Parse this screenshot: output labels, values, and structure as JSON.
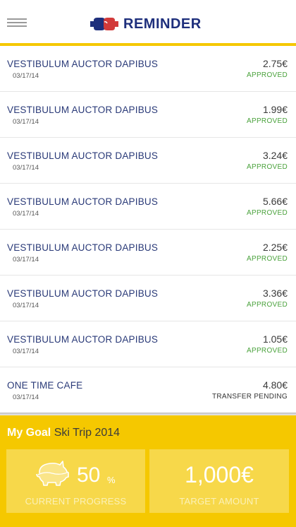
{
  "header": {
    "title": "REMINDER"
  },
  "transactions": [
    {
      "name": "VESTIBULUM AUCTOR DAPIBUS",
      "date": "03/17/14",
      "amount": "2.75€",
      "status": "APPROVED"
    },
    {
      "name": "VESTIBULUM AUCTOR DAPIBUS",
      "date": "03/17/14",
      "amount": "1.99€",
      "status": "APPROVED"
    },
    {
      "name": "VESTIBULUM AUCTOR DAPIBUS",
      "date": "03/17/14",
      "amount": "3.24€",
      "status": "APPROVED"
    },
    {
      "name": "VESTIBULUM AUCTOR DAPIBUS",
      "date": "03/17/14",
      "amount": "5.66€",
      "status": "APPROVED"
    },
    {
      "name": "VESTIBULUM AUCTOR DAPIBUS",
      "date": "03/17/14",
      "amount": "2.25€",
      "status": "APPROVED"
    },
    {
      "name": "VESTIBULUM AUCTOR DAPIBUS",
      "date": "03/17/14",
      "amount": "3.36€",
      "status": "APPROVED"
    },
    {
      "name": "VESTIBULUM AUCTOR DAPIBUS",
      "date": "03/17/14",
      "amount": "1.05€",
      "status": "APPROVED"
    },
    {
      "name": "ONE TIME CAFE",
      "date": "03/17/14",
      "amount": "4.80€",
      "status": "TRANSFER PENDING"
    }
  ],
  "goal": {
    "label": "My Goal",
    "name": "Ski Trip 2014",
    "progress_value": "50",
    "progress_unit": "%",
    "progress_label": "CURRENT PROGRESS",
    "target_value": "1,000€",
    "target_label": "TARGET AMOUNT"
  },
  "colors": {
    "accent": "#f5c800",
    "brand_text": "#1e2f7c",
    "approved": "#4aa23c"
  },
  "icons": {
    "menu": "hamburger-menu-icon",
    "logo": "boxing-gloves-logo",
    "goal": "piggy-bank-icon"
  }
}
